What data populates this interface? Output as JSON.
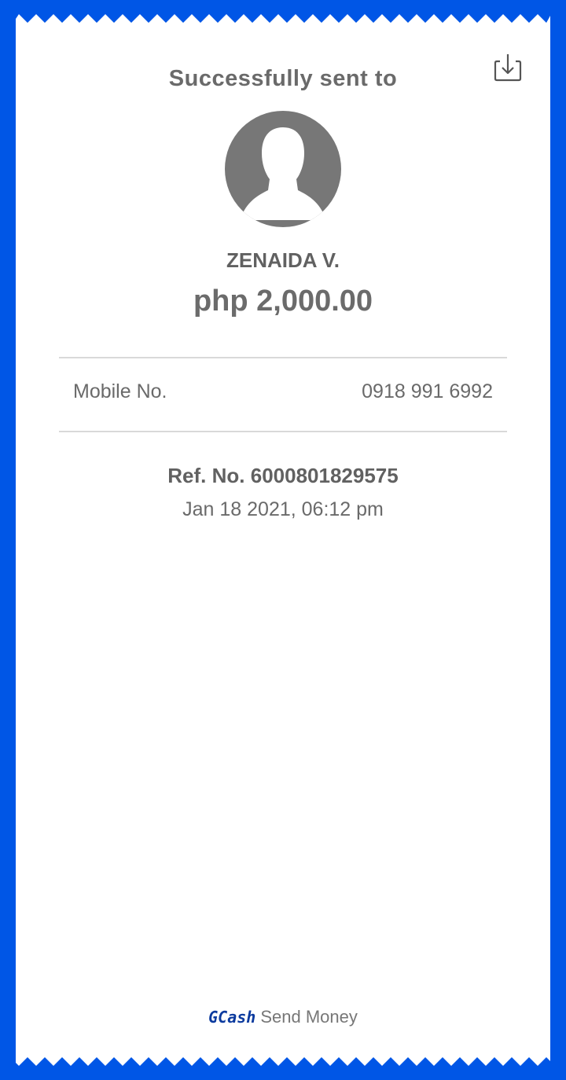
{
  "receipt": {
    "header_title": "Successfully sent to",
    "download_icon": "download-icon",
    "recipient_name": "ZENAIDA V.",
    "amount": "php 2,000.00",
    "mobile_label": "Mobile No.",
    "mobile_value": "0918 991 6992",
    "reference": "Ref. No. 6000801829575",
    "datetime": "Jan 18 2021, 06:12 pm"
  },
  "footer": {
    "brand": "GCash",
    "service": "Send Money"
  },
  "colors": {
    "border": "#0056E6",
    "text": "#6a6a6a",
    "avatar": "#777777",
    "brand": "#0b3a9e"
  }
}
